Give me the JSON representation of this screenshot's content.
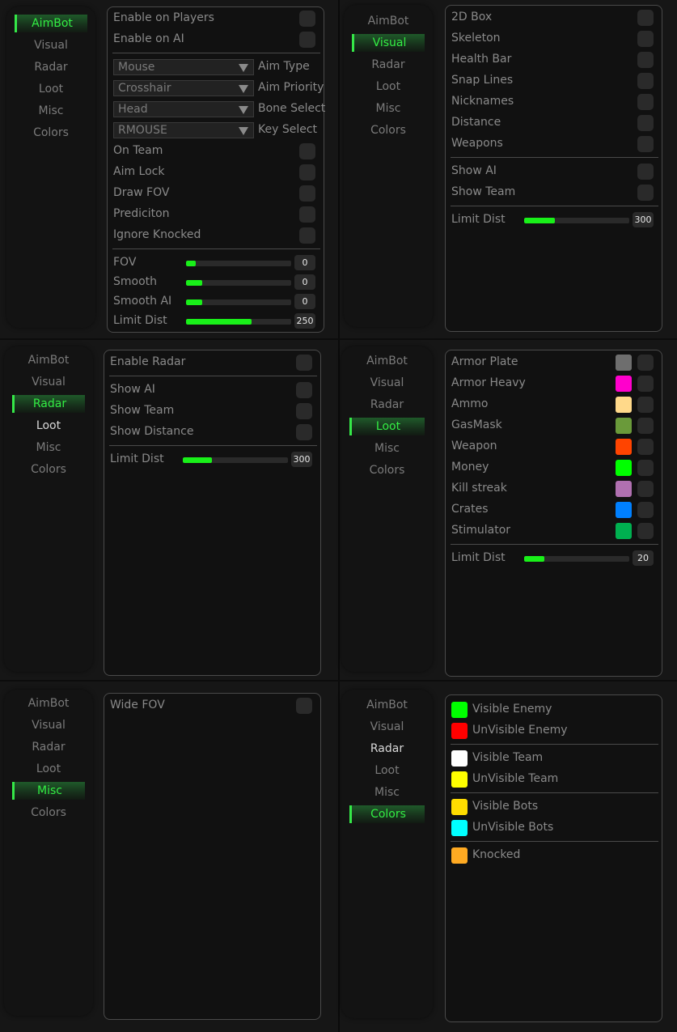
{
  "nav_labels": [
    "AimBot",
    "Visual",
    "Radar",
    "Loot",
    "Misc",
    "Colors"
  ],
  "accent_color": "#33ee44",
  "panels": [
    {
      "active": 0,
      "hover": null,
      "rows": [
        {
          "type": "check",
          "label": "Enable on Players",
          "checked": false
        },
        {
          "type": "check",
          "label": "Enable on AI",
          "checked": false
        },
        {
          "type": "sep"
        },
        {
          "type": "combo",
          "value": "Mouse",
          "label": "Aim Type"
        },
        {
          "type": "combo",
          "value": "Crosshair",
          "label": "Aim Priority"
        },
        {
          "type": "combo",
          "value": "Head",
          "label": "Bone Select"
        },
        {
          "type": "combo",
          "value": "RMOUSE",
          "label": "Key Select"
        },
        {
          "type": "check",
          "label": "On Team",
          "checked": false
        },
        {
          "type": "check",
          "label": "Aim Lock",
          "checked": false
        },
        {
          "type": "check",
          "label": "Draw FOV",
          "checked": false
        },
        {
          "type": "check",
          "label": "Prediciton",
          "checked": false
        },
        {
          "type": "check",
          "label": "Ignore Knocked",
          "checked": false
        },
        {
          "type": "sep"
        },
        {
          "type": "slider",
          "label": "FOV",
          "value": "0",
          "fill": 0.09
        },
        {
          "type": "slider",
          "label": "Smooth",
          "value": "0",
          "fill": 0.15
        },
        {
          "type": "slider",
          "label": "Smooth AI",
          "value": "0",
          "fill": 0.15
        },
        {
          "type": "slider",
          "label": "Limit Dist",
          "value": "250",
          "fill": 0.62
        }
      ]
    },
    {
      "active": 1,
      "hover": null,
      "rows": [
        {
          "type": "check",
          "label": "2D Box",
          "checked": false
        },
        {
          "type": "check",
          "label": "Skeleton",
          "checked": false
        },
        {
          "type": "check",
          "label": "Health Bar",
          "checked": false
        },
        {
          "type": "check",
          "label": "Snap Lines",
          "checked": false
        },
        {
          "type": "check",
          "label": "Nicknames",
          "checked": false
        },
        {
          "type": "check",
          "label": "Distance",
          "checked": false
        },
        {
          "type": "check",
          "label": "Weapons",
          "checked": false
        },
        {
          "type": "sep"
        },
        {
          "type": "check",
          "label": "Show AI",
          "checked": false
        },
        {
          "type": "check",
          "label": "Show Team",
          "checked": false
        },
        {
          "type": "sep"
        },
        {
          "type": "slider",
          "label": "Limit Dist",
          "value": "300",
          "fill": 0.29
        }
      ]
    },
    {
      "active": 2,
      "hover": 3,
      "rows": [
        {
          "type": "check",
          "label": "Enable Radar",
          "checked": false
        },
        {
          "type": "sep"
        },
        {
          "type": "check",
          "label": "Show AI",
          "checked": false
        },
        {
          "type": "check",
          "label": "Show Team",
          "checked": false
        },
        {
          "type": "check",
          "label": "Show Distance",
          "checked": false
        },
        {
          "type": "sep"
        },
        {
          "type": "slider",
          "label": "Limit Dist",
          "value": "300",
          "fill": 0.28
        }
      ]
    },
    {
      "active": 3,
      "hover": null,
      "rows": [
        {
          "type": "colorcheck",
          "label": "Armor Plate",
          "color": "#6e6e6e",
          "checked": false
        },
        {
          "type": "colorcheck",
          "label": "Armor Heavy",
          "color": "#ff00cc",
          "checked": false
        },
        {
          "type": "colorcheck",
          "label": "Ammo",
          "color": "#ffd98a",
          "checked": false
        },
        {
          "type": "colorcheck",
          "label": "GasMask",
          "color": "#6a9a3a",
          "checked": false
        },
        {
          "type": "colorcheck",
          "label": "Weapon",
          "color": "#ff4400",
          "checked": false
        },
        {
          "type": "colorcheck",
          "label": "Money",
          "color": "#00ff00",
          "checked": false
        },
        {
          "type": "colorcheck",
          "label": "Kill streak",
          "color": "#b070b0",
          "checked": false
        },
        {
          "type": "colorcheck",
          "label": "Crates",
          "color": "#0080ff",
          "checked": false
        },
        {
          "type": "colorcheck",
          "label": "Stimulator",
          "color": "#00b050",
          "checked": false
        },
        {
          "type": "sep"
        },
        {
          "type": "slider",
          "label": "Limit Dist",
          "value": "20",
          "fill": 0.19
        }
      ]
    },
    {
      "active": 4,
      "hover": null,
      "rows": [
        {
          "type": "check",
          "label": "Wide FOV",
          "checked": false
        }
      ]
    },
    {
      "active": 5,
      "hover": 2,
      "rows": [
        {
          "type": "color",
          "label": "Visible Enemy",
          "color": "#00ff00"
        },
        {
          "type": "color",
          "label": "UnVisible Enemy",
          "color": "#ff0000"
        },
        {
          "type": "sep"
        },
        {
          "type": "color",
          "label": "Visible Team",
          "color": "#ffffff"
        },
        {
          "type": "color",
          "label": "UnVisible Team",
          "color": "#ffff00"
        },
        {
          "type": "sep"
        },
        {
          "type": "color",
          "label": "Visible Bots",
          "color": "#ffdd00"
        },
        {
          "type": "color",
          "label": "UnVisible Bots",
          "color": "#00ffff"
        },
        {
          "type": "sep"
        },
        {
          "type": "color",
          "label": "Knocked",
          "color": "#ffaa22"
        }
      ]
    }
  ]
}
